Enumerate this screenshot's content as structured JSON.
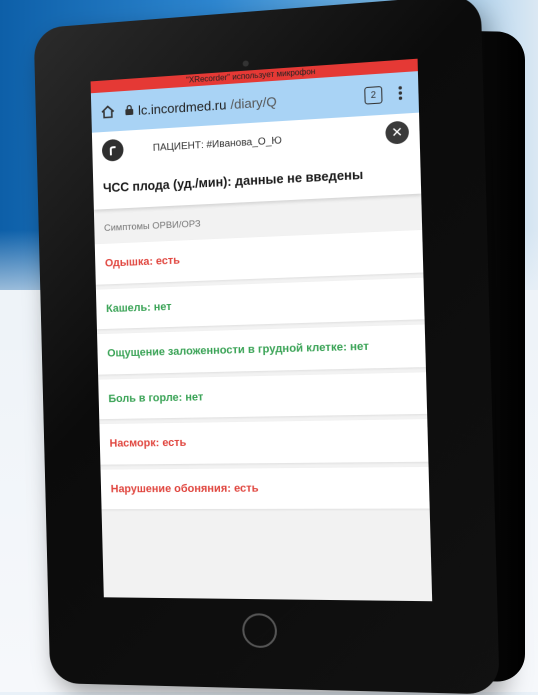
{
  "status_bar": {
    "text": "\"XRecorder\" использует микрофон"
  },
  "browser": {
    "url_host": "lc.incordmed.ru",
    "url_path": "/diary/Q",
    "tab_count": "2",
    "colors": {
      "bar": "#a9d3f5",
      "status": "#e53935"
    }
  },
  "patient": {
    "label": "ПАЦИЕНТ: #Иванова_О_Ю",
    "close_symbol": "✕"
  },
  "heart_rate": {
    "text": "ЧСС плода (уд./мин): данные не введены"
  },
  "section": {
    "title": "Симптомы ОРВИ/ОРЗ"
  },
  "symptoms": [
    {
      "text": "Одышка: есть",
      "status": "positive"
    },
    {
      "text": "Кашель: нет",
      "status": "negative"
    },
    {
      "text": "Ощущение заложенности в грудной клетке: нет",
      "status": "negative"
    },
    {
      "text": "Боль в горле: нет",
      "status": "negative"
    },
    {
      "text": "Насморк: есть",
      "status": "positive"
    },
    {
      "text": "Нарушение обоняния: есть",
      "status": "positive"
    }
  ],
  "status_colors": {
    "positive": "#e0463f",
    "negative": "#3aa356"
  }
}
